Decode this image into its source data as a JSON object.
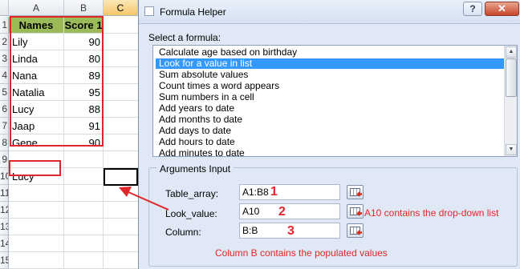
{
  "spreadsheet": {
    "columns": [
      "A",
      "B",
      "C"
    ],
    "rows": [
      "1",
      "2",
      "3",
      "4",
      "5",
      "6",
      "7",
      "8",
      "9",
      "10",
      "11",
      "12",
      "13",
      "14",
      "15"
    ],
    "header": {
      "names": "Names",
      "score": "Score 1"
    },
    "data": [
      {
        "name": "Lily",
        "score": "90"
      },
      {
        "name": "Linda",
        "score": "80"
      },
      {
        "name": "Nana",
        "score": "89"
      },
      {
        "name": "Natalia",
        "score": "95"
      },
      {
        "name": "Lucy",
        "score": "88"
      },
      {
        "name": "Jaap",
        "score": "91"
      },
      {
        "name": "Gene",
        "score": "90"
      }
    ],
    "lookup_cell": "Lucy",
    "header_color": "#9bbb59",
    "highlight_color": "#e0262b"
  },
  "dialog": {
    "title": "Formula Helper",
    "help_label": "?",
    "close_label": "✕",
    "icons": {
      "help": "question-icon",
      "close": "close-icon",
      "app": "app-icon",
      "reference": "cell-reference-icon"
    },
    "select_label": "Select a formula:",
    "formulas": [
      "Calculate age based on birthday",
      "Look for a value in list",
      "Sum absolute values",
      "Count times a word appears",
      "Sum numbers in a cell",
      "Add years to date",
      "Add months to date",
      "Add days to date",
      "Add hours to date",
      "Add minutes to date"
    ],
    "selected_formula": "Look for a value in list",
    "selection_color": "#3399ff",
    "arguments_title": "Arguments Input",
    "arguments": [
      {
        "label": "Table_array:",
        "value": "A1:B8"
      },
      {
        "label": "Look_value:",
        "value": "A10"
      },
      {
        "label": "Column:",
        "value": "B:B"
      }
    ]
  },
  "annotations": {
    "numbers": [
      "1",
      "2",
      "3"
    ],
    "lookup_note": "A10 contains the drop-down list",
    "column_note": "Column B contains the populated values",
    "color": "#e0262b"
  }
}
